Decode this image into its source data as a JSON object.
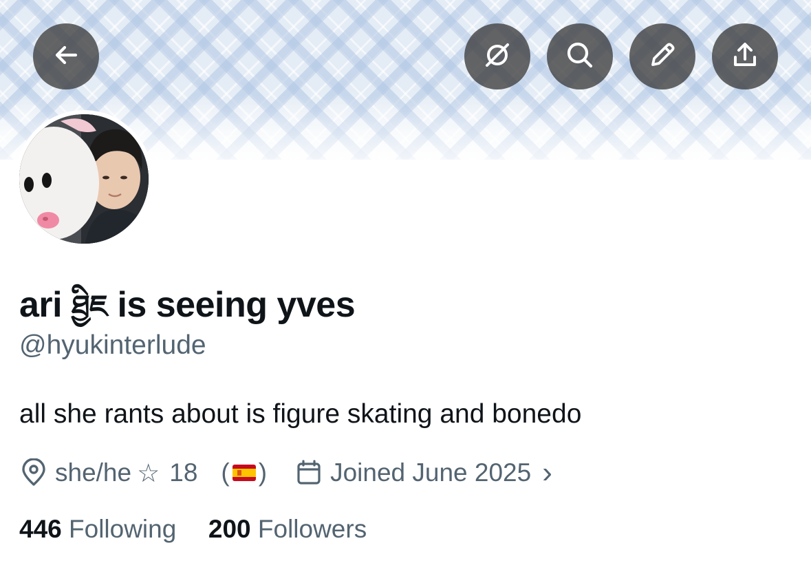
{
  "header": {
    "back_icon": "arrow-left-icon",
    "actions": [
      {
        "name": "grok-icon"
      },
      {
        "name": "search-icon"
      },
      {
        "name": "edit-icon"
      },
      {
        "name": "share-icon"
      }
    ]
  },
  "profile": {
    "name_prefix": "ari",
    "name_symbol": "ཐྱིཇ",
    "name_suffix": "is seeing yves",
    "handle": "@hyukinterlude",
    "bio": "all she rants about is figure skating and bonedo",
    "location": "she/he",
    "star": "☆",
    "age": "18",
    "flag_open": "(",
    "flag_close": ")",
    "flag_icon": "spain-flag-icon",
    "joined": "Joined June 2025",
    "chevron": "›",
    "following_count": "446",
    "following_label": "Following",
    "followers_count": "200",
    "followers_label": "Followers"
  },
  "colors": {
    "text_primary": "#0f1419",
    "text_secondary": "#536471",
    "button_bg": "#3c3c3c"
  }
}
